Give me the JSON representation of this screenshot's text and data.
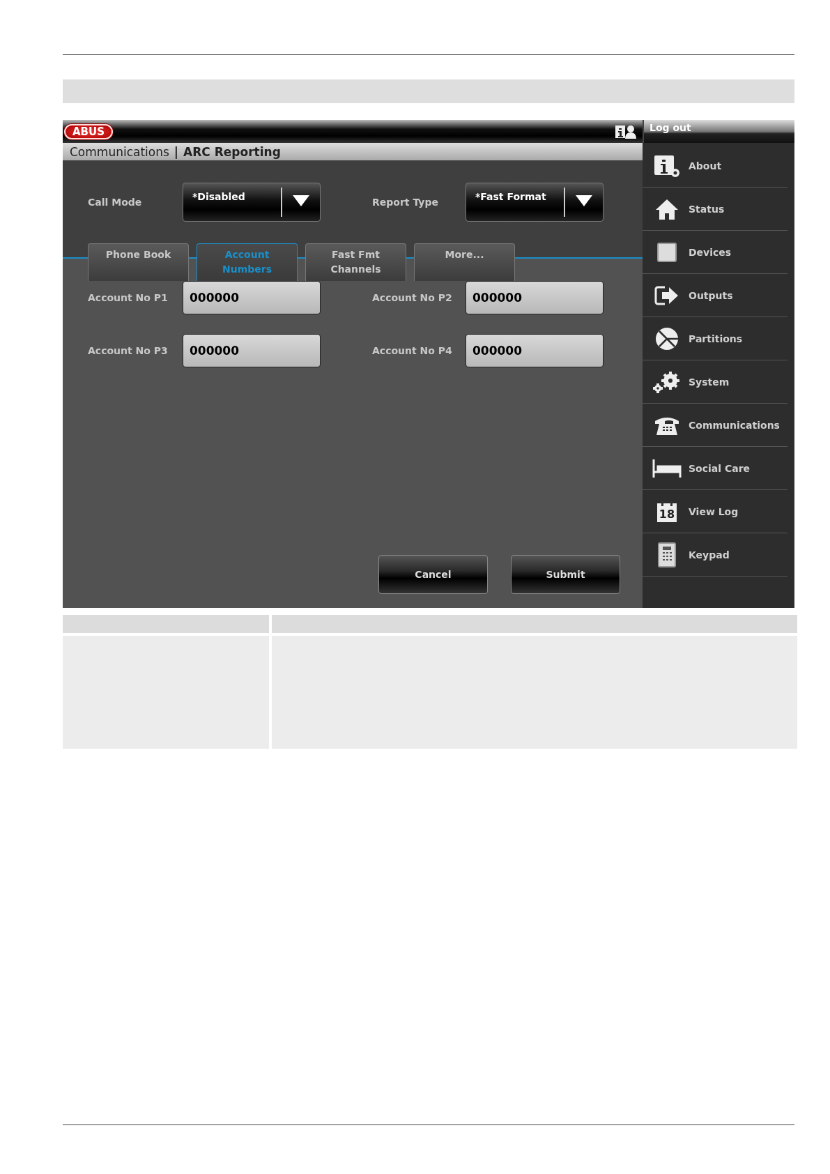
{
  "logo": "ABUS",
  "logout": "Log out",
  "breadcrumb": {
    "section": "Communications",
    "separator": "|",
    "page": "ARC Reporting"
  },
  "dropdowns": [
    {
      "label": "Call Mode",
      "value": "*Disabled"
    },
    {
      "label": "Report Type",
      "value": "*Fast Format"
    }
  ],
  "tabs": [
    {
      "label": "Phone Book",
      "selected": false
    },
    {
      "label": "Account Numbers",
      "selected": true
    },
    {
      "label": "Fast Fmt Channels",
      "selected": false
    },
    {
      "label": "More...",
      "selected": false
    }
  ],
  "fields": [
    {
      "label": "Account No P1",
      "value": "000000"
    },
    {
      "label": "Account No P2",
      "value": "000000"
    },
    {
      "label": "Account No P3",
      "value": "000000"
    },
    {
      "label": "Account No P4",
      "value": "000000"
    }
  ],
  "buttons": [
    "Cancel",
    "Submit"
  ],
  "menu": [
    {
      "label": "About",
      "kind": "about"
    },
    {
      "label": "Status",
      "kind": "status"
    },
    {
      "label": "Devices",
      "kind": "devices"
    },
    {
      "label": "Outputs",
      "kind": "outputs"
    },
    {
      "label": "Partitions",
      "kind": "partitions"
    },
    {
      "label": "System",
      "kind": "system"
    },
    {
      "label": "Communications",
      "kind": "communications"
    },
    {
      "label": "Social Care",
      "kind": "socialcare"
    },
    {
      "label": "View Log",
      "kind": "viewlog",
      "date": "18"
    },
    {
      "label": "Keypad",
      "kind": "keypad"
    }
  ]
}
